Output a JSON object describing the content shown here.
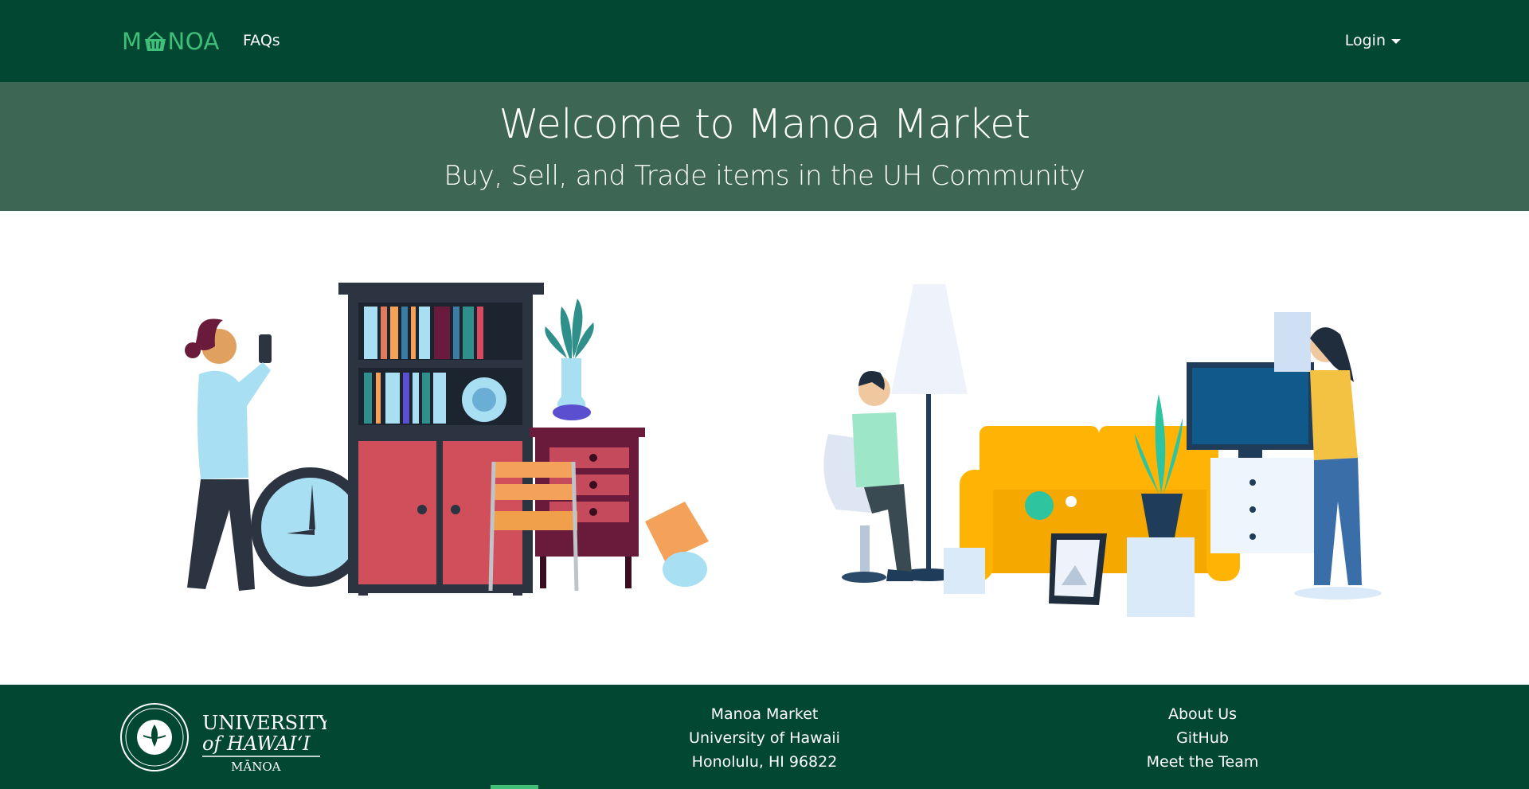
{
  "navbar": {
    "brand_prefix": "M",
    "brand_suffix": "NOA",
    "brand_icon": "basket-icon",
    "faq_label": "FAQs",
    "login_label": "Login"
  },
  "banner": {
    "title": "Welcome to Manoa Market",
    "subtitle": "Buy, Sell, and Trade items in the UH Community"
  },
  "footer": {
    "logo_line1": "UNIVERSITY",
    "logo_line2": "of HAWAI‘I",
    "logo_line3": "MĀNOA",
    "center": [
      "Manoa Market",
      "University of Hawaii",
      "Honolulu, HI 96822"
    ],
    "links": [
      "About Us",
      "GitHub",
      "Meet the Team"
    ]
  },
  "colors": {
    "navbar": "#024731",
    "banner": "#3d6754",
    "brand": "#3fbf77"
  }
}
